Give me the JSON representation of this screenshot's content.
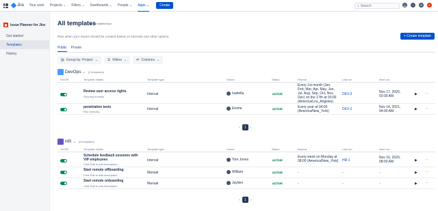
{
  "topnav": {
    "logo": "Jira",
    "items": [
      {
        "label": "Your work"
      },
      {
        "label": "Projects ⌄"
      },
      {
        "label": "Filters ⌄"
      },
      {
        "label": "Dashboards ⌄"
      },
      {
        "label": "People ⌄"
      },
      {
        "label": "Apps ⌄"
      }
    ],
    "create_label": "Create",
    "search_placeholder": "Search",
    "avatar_initial": "S"
  },
  "sidebar": {
    "app_name": "Issue Planner for Jira",
    "items": [
      {
        "label": "Get started"
      },
      {
        "label": "Templates"
      },
      {
        "label": "History"
      }
    ]
  },
  "main": {
    "title": "All templates",
    "get_started": "Get started tour",
    "description": "Plan when your issues should be created based on intervals and other options.",
    "create_button": "+ Create template",
    "tabs": [
      {
        "label": "Public"
      },
      {
        "label": "Private"
      }
    ],
    "filters": [
      {
        "label": "Group by: Project",
        "icon": "group-icon"
      },
      {
        "label": "Filters",
        "icon": "filter-icon"
      },
      {
        "label": "Columns",
        "icon": "columns-icon"
      }
    ],
    "columns": [
      "On/Off",
      "Template details",
      "Template type",
      "Owner",
      "Status",
      "Repeat",
      "Last run",
      "Next run"
    ],
    "groups": [
      {
        "name": "DevOps",
        "count": "(2 templates)",
        "page": "1",
        "rows": [
          {
            "name": "Review user access rights",
            "sub": "Running monthly",
            "type": "Interval",
            "owner": "Isabella",
            "status": "ACTIVE",
            "repeat": "Every 1st month (Jan, Feb, Mar, Apr, May, Jun, Jul, Aug, Sep, Oct, Nov, Dec) on the 17th at 03:00 (America/Los_Angeles)",
            "last_run": "DEV-3",
            "next_run": "Nov 17, 2020, 03:00 AM"
          },
          {
            "name": "penetration tests",
            "sub": "Run annually",
            "type": "Interval",
            "owner": "Emma",
            "status": "ACTIVE",
            "repeat": "Every year at 04:00 (America/New_York)",
            "last_run": "DEV-2",
            "next_run": "Nov 14, 2021, 04:00 AM"
          }
        ]
      },
      {
        "name": "HR",
        "count": "(3 templates)",
        "page": "1",
        "rows": [
          {
            "name": "Schedule feedback sessions with VIP employees",
            "sub": "Click Edit to add description",
            "type": "Interval",
            "owner": "Tom Jones",
            "status": "ACTIVE",
            "repeat": "Every week on Monday at 08:00 (America/New_York)",
            "last_run": "HR-1",
            "next_run": "Nov 16, 2020, 08:00 AM"
          },
          {
            "name": "Start remote offboarding",
            "sub": "Click Edit to add description",
            "type": "Manual",
            "owner": "William",
            "status": "ACTIVE",
            "repeat": "-",
            "last_run": "-",
            "next_run": "-"
          },
          {
            "name": "Start remote onboarding",
            "sub": "Click Edit to add description",
            "type": "Manual",
            "owner": "Jayden",
            "status": "ACTIVE",
            "repeat": "-",
            "last_run": "-",
            "next_run": "-"
          }
        ]
      }
    ]
  }
}
